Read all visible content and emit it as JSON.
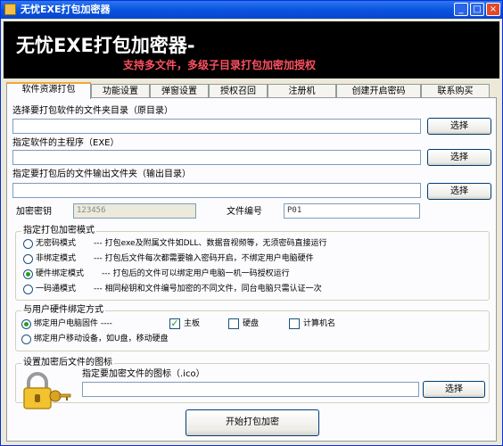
{
  "window": {
    "title": "无忧EXE打包加密器",
    "controls": [
      "_",
      "□",
      "×"
    ]
  },
  "banner": {
    "title": "无忧EXE打包加密器-",
    "subtitle": "支持多文件，多级子目录打包加密加授权"
  },
  "tabs": [
    "软件资源打包",
    "功能设置",
    "弹窗设置",
    "授权召回",
    "注册机",
    "创建开启密码",
    "联系购买"
  ],
  "fields": {
    "source_dir_label": "选择要打包软件的文件夹目录（原目录）",
    "main_exe_label": "指定软件的主程序（EXE）",
    "output_dir_label": "指定要打包后的文件输出文件夹（输出目录）",
    "browse_label": "选择",
    "key_label": "加密密钥",
    "key_value": "123456",
    "file_no_label": "文件编号",
    "file_no_value": "P01"
  },
  "mode_group": {
    "title": "指定打包加密模式",
    "options": [
      {
        "name": "无密码模式",
        "desc": "--- 打包exe及附属文件如DLL、数据音视频等，无须密码直接运行",
        "selected": false
      },
      {
        "name": "非绑定模式",
        "desc": "--- 打包后文件每次都需要输入密码开启，不绑定用户电脑硬件",
        "selected": false
      },
      {
        "name": "硬件绑定模式",
        "desc": "--- 打包后的文件可以绑定用户电脑一机一码授权运行",
        "selected": true
      },
      {
        "name": "一码通模式",
        "desc": "--- 相同秘钥和文件编号加密的不同文件，同台电脑只需认证一次",
        "selected": false
      }
    ]
  },
  "hw_group": {
    "title": "与用户硬件绑定方式",
    "bind_pc": "绑定用户电脑固件 ----",
    "bind_usb": "绑定用户移动设备，如U盘，移动硬盘",
    "checks": [
      {
        "label": "主板",
        "checked": true
      },
      {
        "label": "硬盘",
        "checked": false
      },
      {
        "label": "计算机名",
        "checked": false
      }
    ]
  },
  "icon_group": {
    "title": "设置加密后文件的图标",
    "label": "指定要加密文件的图标（.ico）"
  },
  "start_button": "开始打包加密",
  "colors": {
    "titlebar": "#0a53e0",
    "banner_bg": "#000000",
    "subtitle": "#ff5060",
    "tab_accent": "#f1a63a"
  }
}
